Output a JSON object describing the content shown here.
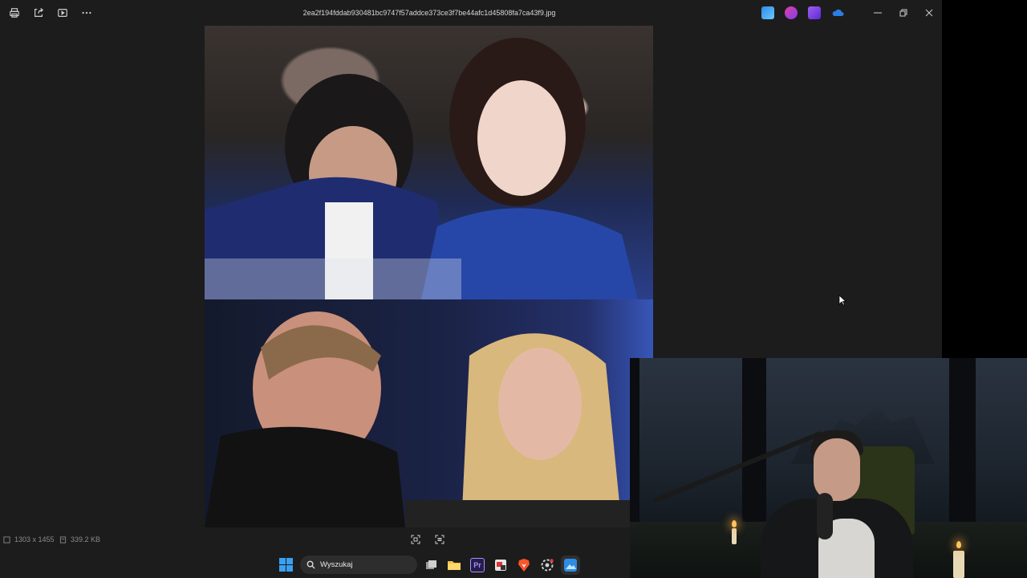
{
  "app": {
    "filename": "2ea2f194fddab930481bc9747f57addce373ce3f7be44afc1d45808fa7ca43f9.jpg",
    "toolbar_icons": [
      "print-icon",
      "share-icon",
      "slideshow-icon",
      "more-icon"
    ],
    "extension_icons": [
      "edit-icon",
      "designer-icon",
      "clipchamp-icon",
      "onedrive-icon"
    ],
    "window_controls": [
      "minimize-icon",
      "restore-icon",
      "close-icon"
    ]
  },
  "status": {
    "dimensions": "1303 x 1455",
    "file_size": "339.2 KB"
  },
  "taskbar": {
    "search_placeholder": "Wyszukaj",
    "apps": [
      "task-view",
      "file-explorer",
      "premiere-pro",
      "photo-tool",
      "brave-browser",
      "settings",
      "photos"
    ]
  },
  "colors": {
    "window_bg": "#1c1c1c",
    "accent": "#3aa0f0",
    "brave": "#fb542b",
    "premiere": "#9999ff"
  }
}
